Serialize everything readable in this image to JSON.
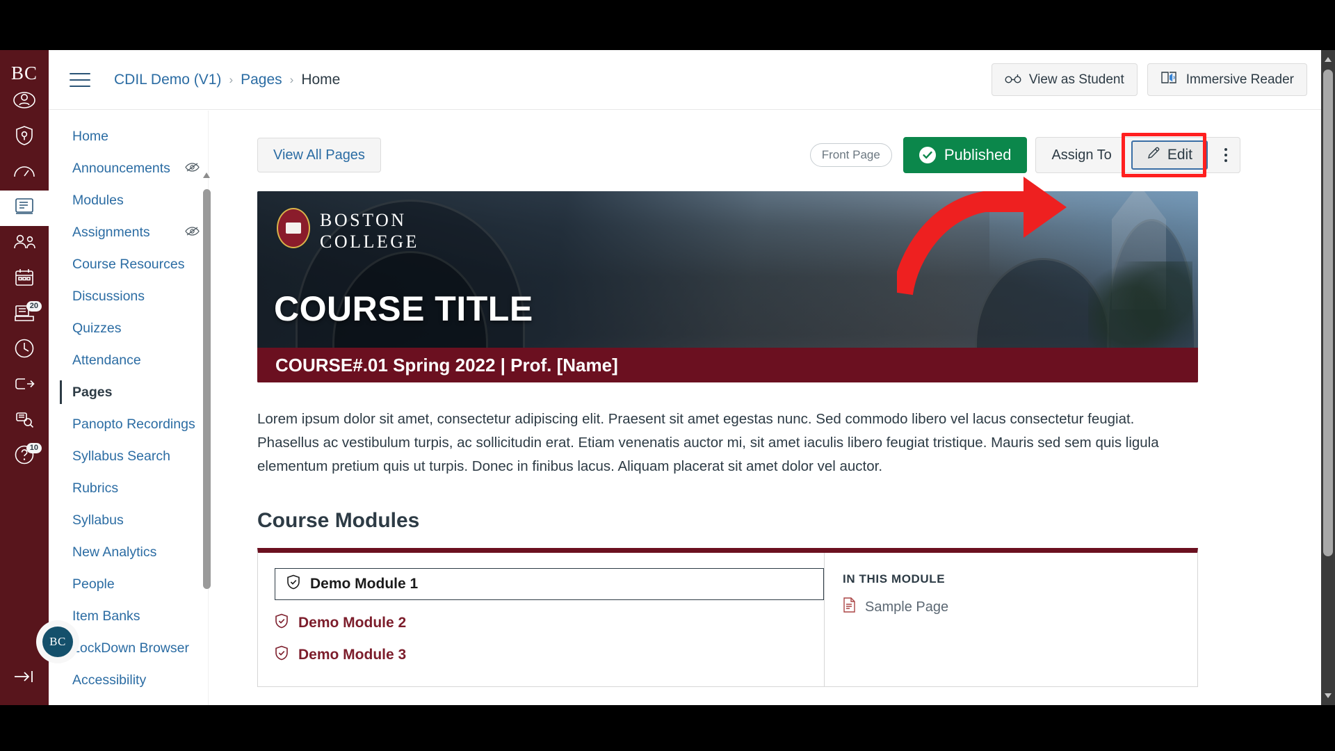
{
  "global_nav": {
    "logo": "BC",
    "items": [
      {
        "name": "account",
        "icon": "user-icon",
        "badge": ""
      },
      {
        "name": "admin",
        "icon": "shield-key-icon",
        "badge": ""
      },
      {
        "name": "dashboard",
        "icon": "speedometer-icon",
        "badge": ""
      },
      {
        "name": "courses",
        "icon": "book-icon",
        "badge": "",
        "active": true
      },
      {
        "name": "groups",
        "icon": "people-icon",
        "badge": ""
      },
      {
        "name": "calendar",
        "icon": "calendar-icon",
        "badge": ""
      },
      {
        "name": "inbox",
        "icon": "inbox-icon",
        "badge": "20"
      },
      {
        "name": "history",
        "icon": "clock-icon",
        "badge": ""
      },
      {
        "name": "commons",
        "icon": "export-icon",
        "badge": ""
      },
      {
        "name": "studio",
        "icon": "studio-icon",
        "badge": ""
      },
      {
        "name": "help",
        "icon": "question-icon",
        "badge": "10"
      }
    ],
    "collapse_label": "→|",
    "avatar_initials": "BC"
  },
  "header": {
    "menu_icon": "hamburger-icon",
    "breadcrumb": [
      {
        "label": "CDIL Demo (V1)",
        "current": false
      },
      {
        "label": "Pages",
        "current": false
      },
      {
        "label": "Home",
        "current": true
      }
    ],
    "separator": "›",
    "view_as_student_label": "View as Student",
    "view_as_student_icon": "eyeglasses-icon",
    "immersive_reader_label": "Immersive Reader",
    "immersive_reader_icon": "immersive-reader-icon"
  },
  "course_nav": {
    "items": [
      {
        "label": "Home",
        "hidden": false,
        "active": false
      },
      {
        "label": "Announcements",
        "hidden": true,
        "active": false
      },
      {
        "label": "Modules",
        "hidden": false,
        "active": false
      },
      {
        "label": "Assignments",
        "hidden": true,
        "active": false
      },
      {
        "label": "Course Resources",
        "hidden": false,
        "active": false
      },
      {
        "label": "Discussions",
        "hidden": false,
        "active": false
      },
      {
        "label": "Quizzes",
        "hidden": false,
        "active": false
      },
      {
        "label": "Attendance",
        "hidden": false,
        "active": false
      },
      {
        "label": "Pages",
        "hidden": false,
        "active": true
      },
      {
        "label": "Panopto Recordings",
        "hidden": false,
        "active": false
      },
      {
        "label": "Syllabus Search",
        "hidden": false,
        "active": false
      },
      {
        "label": "Rubrics",
        "hidden": false,
        "active": false
      },
      {
        "label": "Syllabus",
        "hidden": false,
        "active": false
      },
      {
        "label": "New Analytics",
        "hidden": false,
        "active": false
      },
      {
        "label": "People",
        "hidden": false,
        "active": false
      },
      {
        "label": "Item Banks",
        "hidden": false,
        "active": false
      },
      {
        "label": "LockDown Browser",
        "hidden": false,
        "active": false
      },
      {
        "label": "Accessibility",
        "hidden": false,
        "active": false
      }
    ]
  },
  "page_toolbar": {
    "view_all_pages_label": "View All Pages",
    "front_page_badge": "Front Page",
    "published_label": "Published",
    "published_color": "#0b874b",
    "assign_to_label": "Assign To",
    "edit_label": "Edit",
    "edit_icon": "pencil-icon",
    "kebab_label": "More options",
    "highlight_color": "#ff1f1f"
  },
  "annotation": {
    "arrow": "red-curved-arrow",
    "arrow_color": "#ee2020",
    "points_to": "edit-button"
  },
  "banner": {
    "institution_line1": "BOSTON",
    "institution_line2": "COLLEGE",
    "course_title": "COURSE TITLE",
    "course_meta": "COURSE#.01 Spring 2022 | Prof. [Name]",
    "accent_color": "#6b1020"
  },
  "body": {
    "paragraph": "Lorem ipsum dolor sit amet, consectetur adipiscing elit. Praesent sit amet egestas nunc. Sed commodo libero vel lacus consectetur feugiat. Phasellus ac vestibulum turpis, ac sollicitudin erat. Etiam venenatis auctor mi, sit amet iaculis libero feugiat tristique. Mauris sed sem quis ligula elementum pretium quis ut turpis. Donec in finibus lacus. Aliquam placerat sit amet dolor vel auctor."
  },
  "modules": {
    "heading": "Course Modules",
    "items": [
      {
        "label": "Demo Module 1",
        "selected": true
      },
      {
        "label": "Demo Module 2",
        "selected": false
      },
      {
        "label": "Demo Module 3",
        "selected": false
      }
    ],
    "in_this_module_label": "IN THIS MODULE",
    "pages": [
      {
        "label": "Sample Page",
        "icon": "document-icon"
      }
    ]
  }
}
